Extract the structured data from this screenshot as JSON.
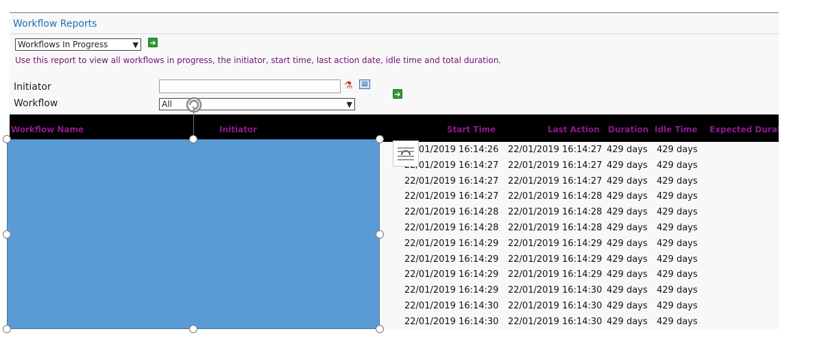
{
  "report": {
    "title": "Workflow Reports",
    "selected_report": "Workflows In Progress",
    "description": "Use this report to view all workflows in progress, the initiator, start time, last action date, idle time and total duration."
  },
  "filters": {
    "initiator_label": "Initiator",
    "initiator_value": "",
    "workflow_label": "Workflow",
    "workflow_value": "All"
  },
  "table": {
    "columns": [
      "Workflow Name",
      "Initiator",
      "Start Time",
      "Last Action",
      "Duration",
      "Idle Time",
      "Expected Durat"
    ],
    "rows": [
      {
        "start": "22/01/2019 16:14:26",
        "last": "22/01/2019 16:14:27",
        "duration": "429 days",
        "idle": "429 days"
      },
      {
        "start": "22/01/2019 16:14:27",
        "last": "22/01/2019 16:14:27",
        "duration": "429 days",
        "idle": "429 days"
      },
      {
        "start": "22/01/2019 16:14:27",
        "last": "22/01/2019 16:14:27",
        "duration": "429 days",
        "idle": "429 days"
      },
      {
        "start": "22/01/2019 16:14:27",
        "last": "22/01/2019 16:14:28",
        "duration": "429 days",
        "idle": "429 days"
      },
      {
        "start": "22/01/2019 16:14:28",
        "last": "22/01/2019 16:14:28",
        "duration": "429 days",
        "idle": "429 days"
      },
      {
        "start": "22/01/2019 16:14:28",
        "last": "22/01/2019 16:14:28",
        "duration": "429 days",
        "idle": "429 days"
      },
      {
        "start": "22/01/2019 16:14:29",
        "last": "22/01/2019 16:14:29",
        "duration": "429 days",
        "idle": "429 days"
      },
      {
        "start": "22/01/2019 16:14:29",
        "last": "22/01/2019 16:14:29",
        "duration": "429 days",
        "idle": "429 days"
      },
      {
        "start": "22/01/2019 16:14:29",
        "last": "22/01/2019 16:14:29",
        "duration": "429 days",
        "idle": "429 days"
      },
      {
        "start": "22/01/2019 16:14:29",
        "last": "22/01/2019 16:14:30",
        "duration": "429 days",
        "idle": "429 days"
      },
      {
        "start": "22/01/2019 16:14:30",
        "last": "22/01/2019 16:14:30",
        "duration": "429 days",
        "idle": "429 days"
      },
      {
        "start": "22/01/2019 16:14:30",
        "last": "22/01/2019 16:14:30",
        "duration": "429 days",
        "idle": "429 days"
      }
    ]
  },
  "icons": {
    "go": "green-arrow-icon",
    "people_picker": "check-names-icon",
    "browse": "address-book-icon",
    "rotate": "rotate-handle-icon",
    "layout": "layout-options-icon"
  },
  "colors": {
    "title": "#1a6fb5",
    "description": "#6e1376",
    "header_bg": "#000000",
    "header_text": "#8c1a8c",
    "overlay_shape": "#5b9bd5",
    "go_button": "#2e9b2e"
  }
}
